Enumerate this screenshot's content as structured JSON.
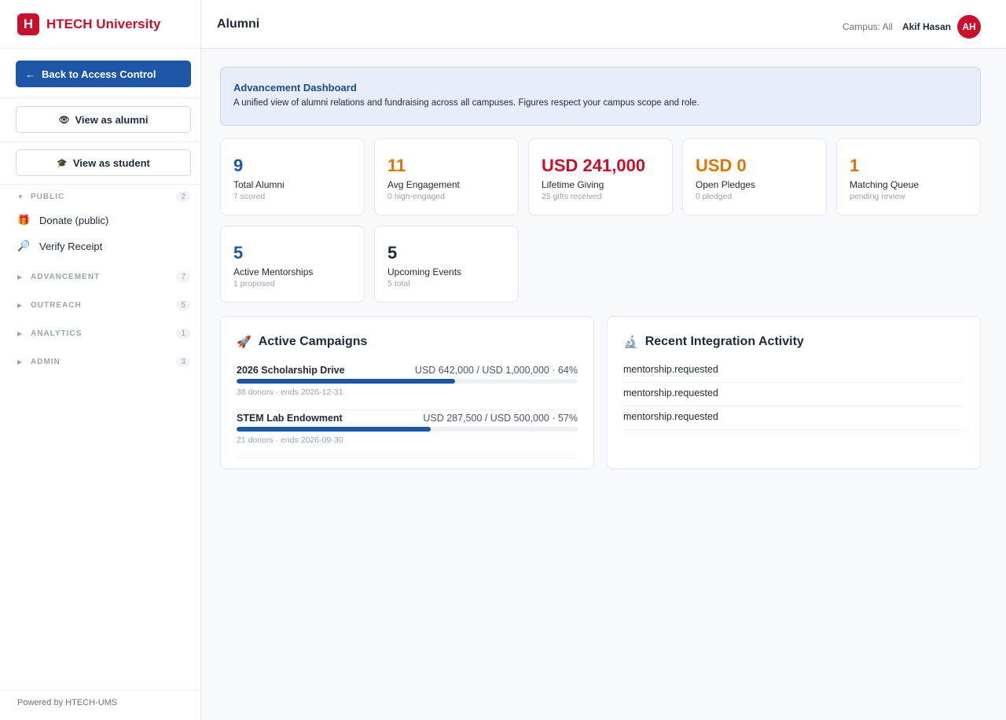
{
  "brand": {
    "logo_letter": "H",
    "name": "HTECH University",
    "color": "#c8102e"
  },
  "sidebar": {
    "back_label": "Back to Access Control",
    "view_alumni_label": "View as alumni",
    "view_student_label": "View as student",
    "sections": [
      {
        "name": "PUBLIC",
        "count": "2",
        "expanded": true,
        "items": [
          {
            "label": "Donate (public)",
            "icon": "gift-icon"
          },
          {
            "label": "Verify Receipt",
            "icon": "magnifier-icon"
          }
        ]
      },
      {
        "name": "ADVANCEMENT",
        "count": "7",
        "expanded": false
      },
      {
        "name": "OUTREACH",
        "count": "5",
        "expanded": false
      },
      {
        "name": "ANALYTICS",
        "count": "1",
        "expanded": false
      },
      {
        "name": "ADMIN",
        "count": "3",
        "expanded": false
      }
    ],
    "footer": "Powered by HTECH-UMS"
  },
  "header": {
    "title": "Alumni",
    "campus": "Campus: All",
    "user_name": "Akif Hasan",
    "user_initials": "AH"
  },
  "banner": {
    "title": "Advancement Dashboard",
    "text": "A unified view of alumni relations and fundraising across all campuses. Figures respect your campus scope and role."
  },
  "stats": [
    {
      "value": "9",
      "label": "Total Alumni",
      "sub": "7 scored",
      "color": "#1d56a7"
    },
    {
      "value": "11",
      "label": "Avg Engagement",
      "sub": "0 high-engaged",
      "color": "#d97706"
    },
    {
      "value": "USD 241,000",
      "label": "Lifetime Giving",
      "sub": "25 gifts received",
      "color": "#c8102e"
    },
    {
      "value": "USD 0",
      "label": "Open Pledges",
      "sub": "0 pledged",
      "color": "#d97706"
    },
    {
      "value": "1",
      "label": "Matching Queue",
      "sub": "pending review",
      "color": "#d97706"
    },
    {
      "value": "5",
      "label": "Active Mentorships",
      "sub": "1 proposed",
      "color": "#1d56a7"
    },
    {
      "value": "5",
      "label": "Upcoming Events",
      "sub": "5 total",
      "color": "#1f2937"
    }
  ],
  "campaigns_panel": {
    "title": "Active Campaigns",
    "campaigns": [
      {
        "name": "2026 Scholarship Drive",
        "amount": "USD 642,000 / USD 1,000,000 · 64%",
        "progress": 0.64,
        "meta": "38 donors · ends 2026-12-31"
      },
      {
        "name": "STEM Lab Endowment",
        "amount": "USD 287,500 / USD 500,000 · 57%",
        "progress": 0.57,
        "meta": "21 donors · ends 2026-09-30"
      }
    ]
  },
  "activity_panel": {
    "title": "Recent Integration Activity",
    "items": [
      "mentorship.requested",
      "mentorship.requested",
      "mentorship.requested"
    ]
  }
}
